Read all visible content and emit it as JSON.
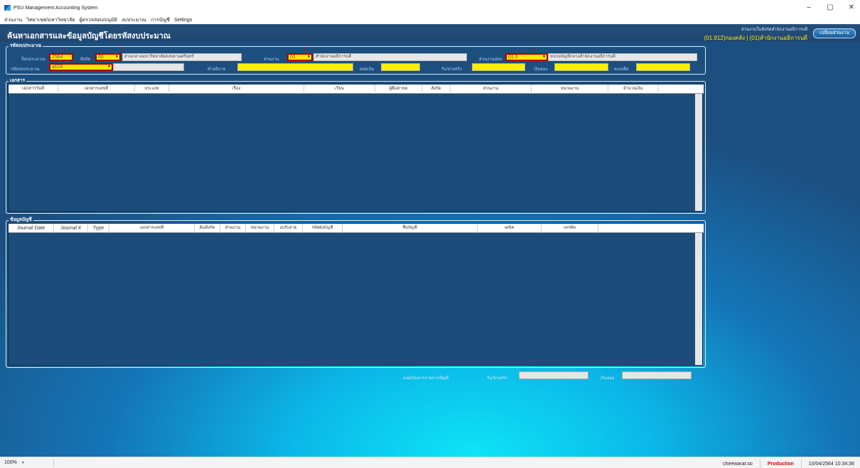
{
  "window": {
    "title": "PSU Management Accounting System",
    "controls": [
      "–",
      "▢",
      "✕"
    ]
  },
  "menu": [
    "ส่วนงาน",
    "วิทยาเขต/มหาวิทยาลัย",
    "ผู้ตรวจสอบ/อนุมัติ",
    "งบประมาณ",
    "การบัญชี",
    "Settings"
  ],
  "header": {
    "title": "ค้นหาเอกสารและข้อมูลบัญชีโดยรหัสงบประมาณ",
    "user_dept_line": "ส่วนงานในสังกัดสำนักงานอธิการบดี",
    "user_org": "(01.912)กองคลัง | (01)สำนักงานอธิการบดี",
    "change_dept_button": "เปลี่ยนส่วนงาน"
  },
  "budget_group": {
    "label": "รหัสงบประมาณ",
    "fiscal_year_label": "ปีงบประมาณ",
    "fiscal_year_value": "2564",
    "affiliation_label": "สังกัด",
    "affiliation_value": "00",
    "affiliation_desc": "ส่วนกลางมหาวิทยาลัยสงขลานครินทร์",
    "unit_label": "ส่วนงาน",
    "unit_value": "01",
    "unit_desc": "สำนักงานอธิการบดี",
    "subunit_label": "ส่วนงานย่อย",
    "subunit_value": "01.0",
    "subunit_desc": "หน่วยบัญชีกลางสำนักงานอธิการบดี",
    "budget_code_label": "รหัสงบประมาณ",
    "budget_code_value": "a026",
    "description_label": "คำอธิบาย",
    "amount_label": "ยอดเงิน",
    "actual_label": "รับ/จ่ายจริง",
    "reserve_label": "เงินจอง",
    "balance_label": "คงเหลือ",
    "markers": [
      "1",
      "2",
      "3",
      "4",
      "5"
    ]
  },
  "documents": {
    "label": "เอกสาร",
    "columns": [
      "เอกสารวันที่",
      "เอกสารเลขที่",
      "ประเภท",
      "เรื่อง",
      "เรียน",
      "ผู้ยืมค่าขอ",
      "สังกัด",
      "ส่วนงาน",
      "หน่วยงาน",
      "จำนวนเงิน"
    ]
  },
  "accounts": {
    "label": "ข้อมูลบัญชี",
    "columns": [
      "Journal Date",
      "Journal #",
      "Type",
      "เอกสารเลขที่",
      "ต้นสังกัด",
      "ส่วนงาน",
      "หน่วยงาน",
      "งบรับจ่าย",
      "รหัสผังบัญชี",
      "ชื่อบัญชี",
      "เดบิต",
      "เครดิต"
    ]
  },
  "footer": {
    "amount_from_accounts_label": "ยอดเงินจากรายการบัญชี",
    "actual_label": "รับ/จ่ายจริง",
    "reserve_label": "เงินจอง"
  },
  "statusbar": {
    "zoom": "100%",
    "user": "cheewarat.so",
    "environment": "Production",
    "datetime": "10/04/2564 10:34:36"
  }
}
